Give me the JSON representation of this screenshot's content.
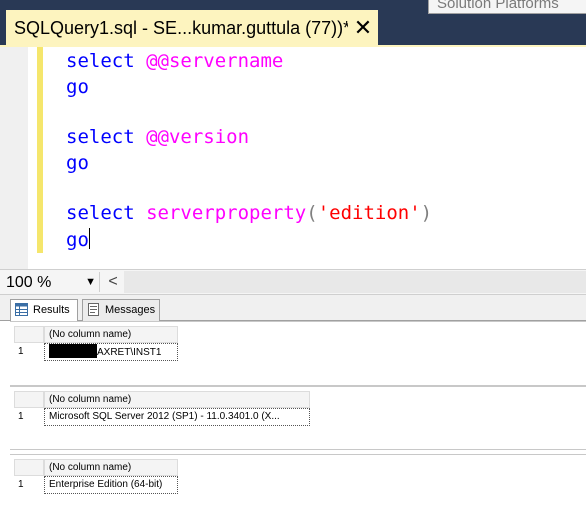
{
  "window": {
    "solution_box_text": "Solution Platforms",
    "tab_title": "SQLQuery1.sql - SE...kumar.guttula (77))*",
    "close_glyph": "✕"
  },
  "editor": {
    "lines": [
      {
        "kw": "select",
        "rest": "@@servername"
      },
      {
        "kw": "go"
      },
      {
        "kw": "select",
        "rest": "@@version"
      },
      {
        "kw": "go"
      },
      {
        "kw": "select",
        "func": "serverproperty",
        "open": "(",
        "str": "'edition'",
        "close": ")"
      },
      {
        "kw": "go"
      }
    ]
  },
  "zoom": {
    "value": "100 %",
    "arrow": "▼",
    "scroll_left": "<"
  },
  "results_tabs": [
    {
      "label": "Results",
      "icon": "grid-icon"
    },
    {
      "label": "Messages",
      "icon": "messages-icon"
    }
  ],
  "grids": [
    {
      "header": "(No column name)",
      "row_number": "1",
      "value": "AXRET\\INST1",
      "redacted_prefix": true
    },
    {
      "header": "(No column name)",
      "row_number": "1",
      "value": "Microsoft SQL Server 2012 (SP1) - 11.0.3401.0 (X..."
    },
    {
      "header": "(No column name)",
      "row_number": "1",
      "value": "Enterprise Edition (64-bit)"
    }
  ],
  "colors": {
    "keyword": "#0000ff",
    "system_variable": "#ff00ff",
    "string": "#ff0000",
    "tab_background": "#fdf4bf",
    "chrome_dark": "#293955"
  }
}
